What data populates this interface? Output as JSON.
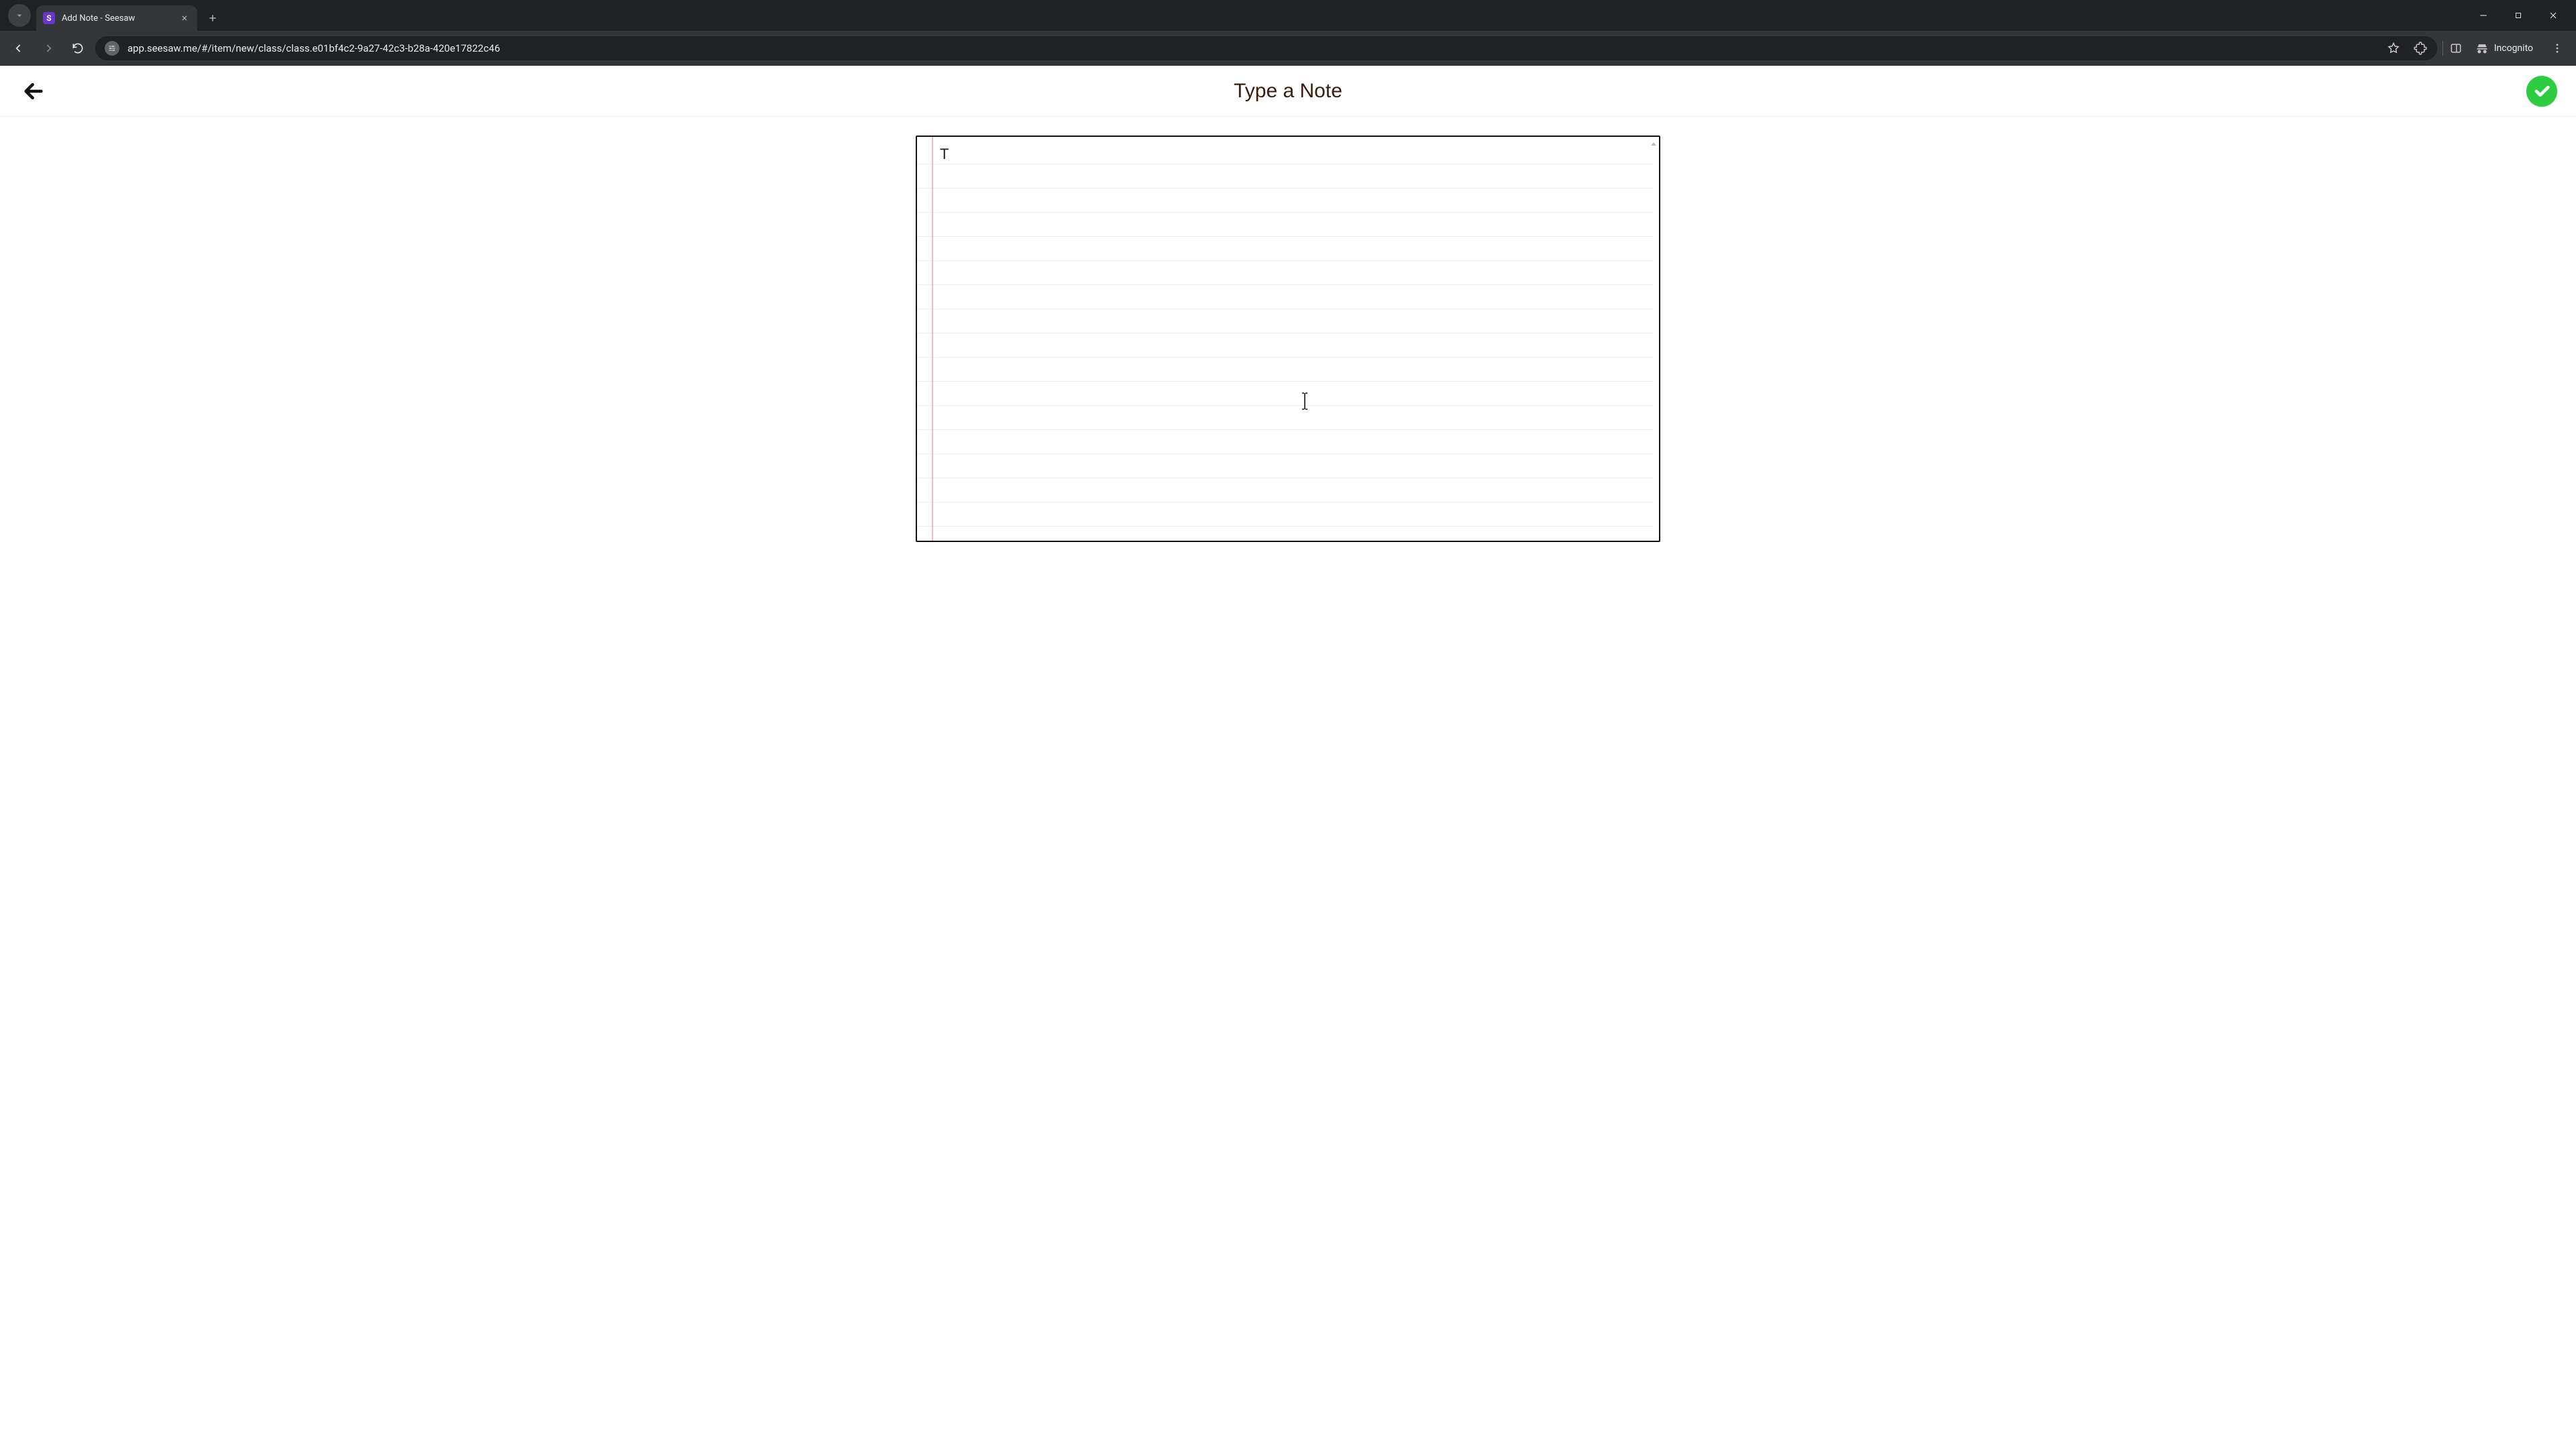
{
  "browser": {
    "tab": {
      "title": "Add Note - Seesaw",
      "favicon_letter": "S"
    },
    "url": "app.seesaw.me/#/item/new/class/class.e01bf4c2-9a27-42c3-b28a-420e17822c46",
    "incognito_label": "Incognito"
  },
  "header": {
    "title": "Type a Note"
  },
  "note": {
    "value": "T"
  },
  "colors": {
    "confirm_green": "#2ecc40",
    "favicon_purple": "#6a36c9"
  }
}
